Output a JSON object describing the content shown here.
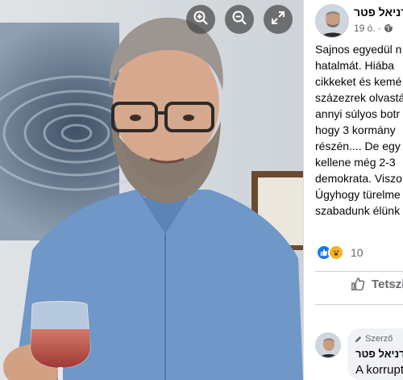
{
  "viewer": {
    "zoom_in_icon": "zoom-in-icon",
    "zoom_out_icon": "zoom-out-icon",
    "fullscreen_icon": "fullscreen-icon"
  },
  "post": {
    "author": "דניאל פטר",
    "time": "19 ó.",
    "privacy_icon": "globe-icon",
    "text_lines": [
      "Sajnos egyedül n",
      "hatalmát. Hiába",
      "cikkeket és kemé",
      "százezrek olvastá",
      "annyi súlyos botr",
      "hogy 3 kormány",
      "részén.... De egy",
      "kellene még 2-3",
      "demokrata. Viszo",
      "Úgyhogy türelme",
      "szabadunk élünk"
    ],
    "reaction_count": "10",
    "like_label": "Tetszi"
  },
  "comment": {
    "badge": "Szerző",
    "author": "דניאל פטר",
    "text": "A korrupt"
  },
  "colors": {
    "brand": "#1877f2",
    "secondary_text": "#65676b",
    "bubble": "#f0f2f5"
  }
}
